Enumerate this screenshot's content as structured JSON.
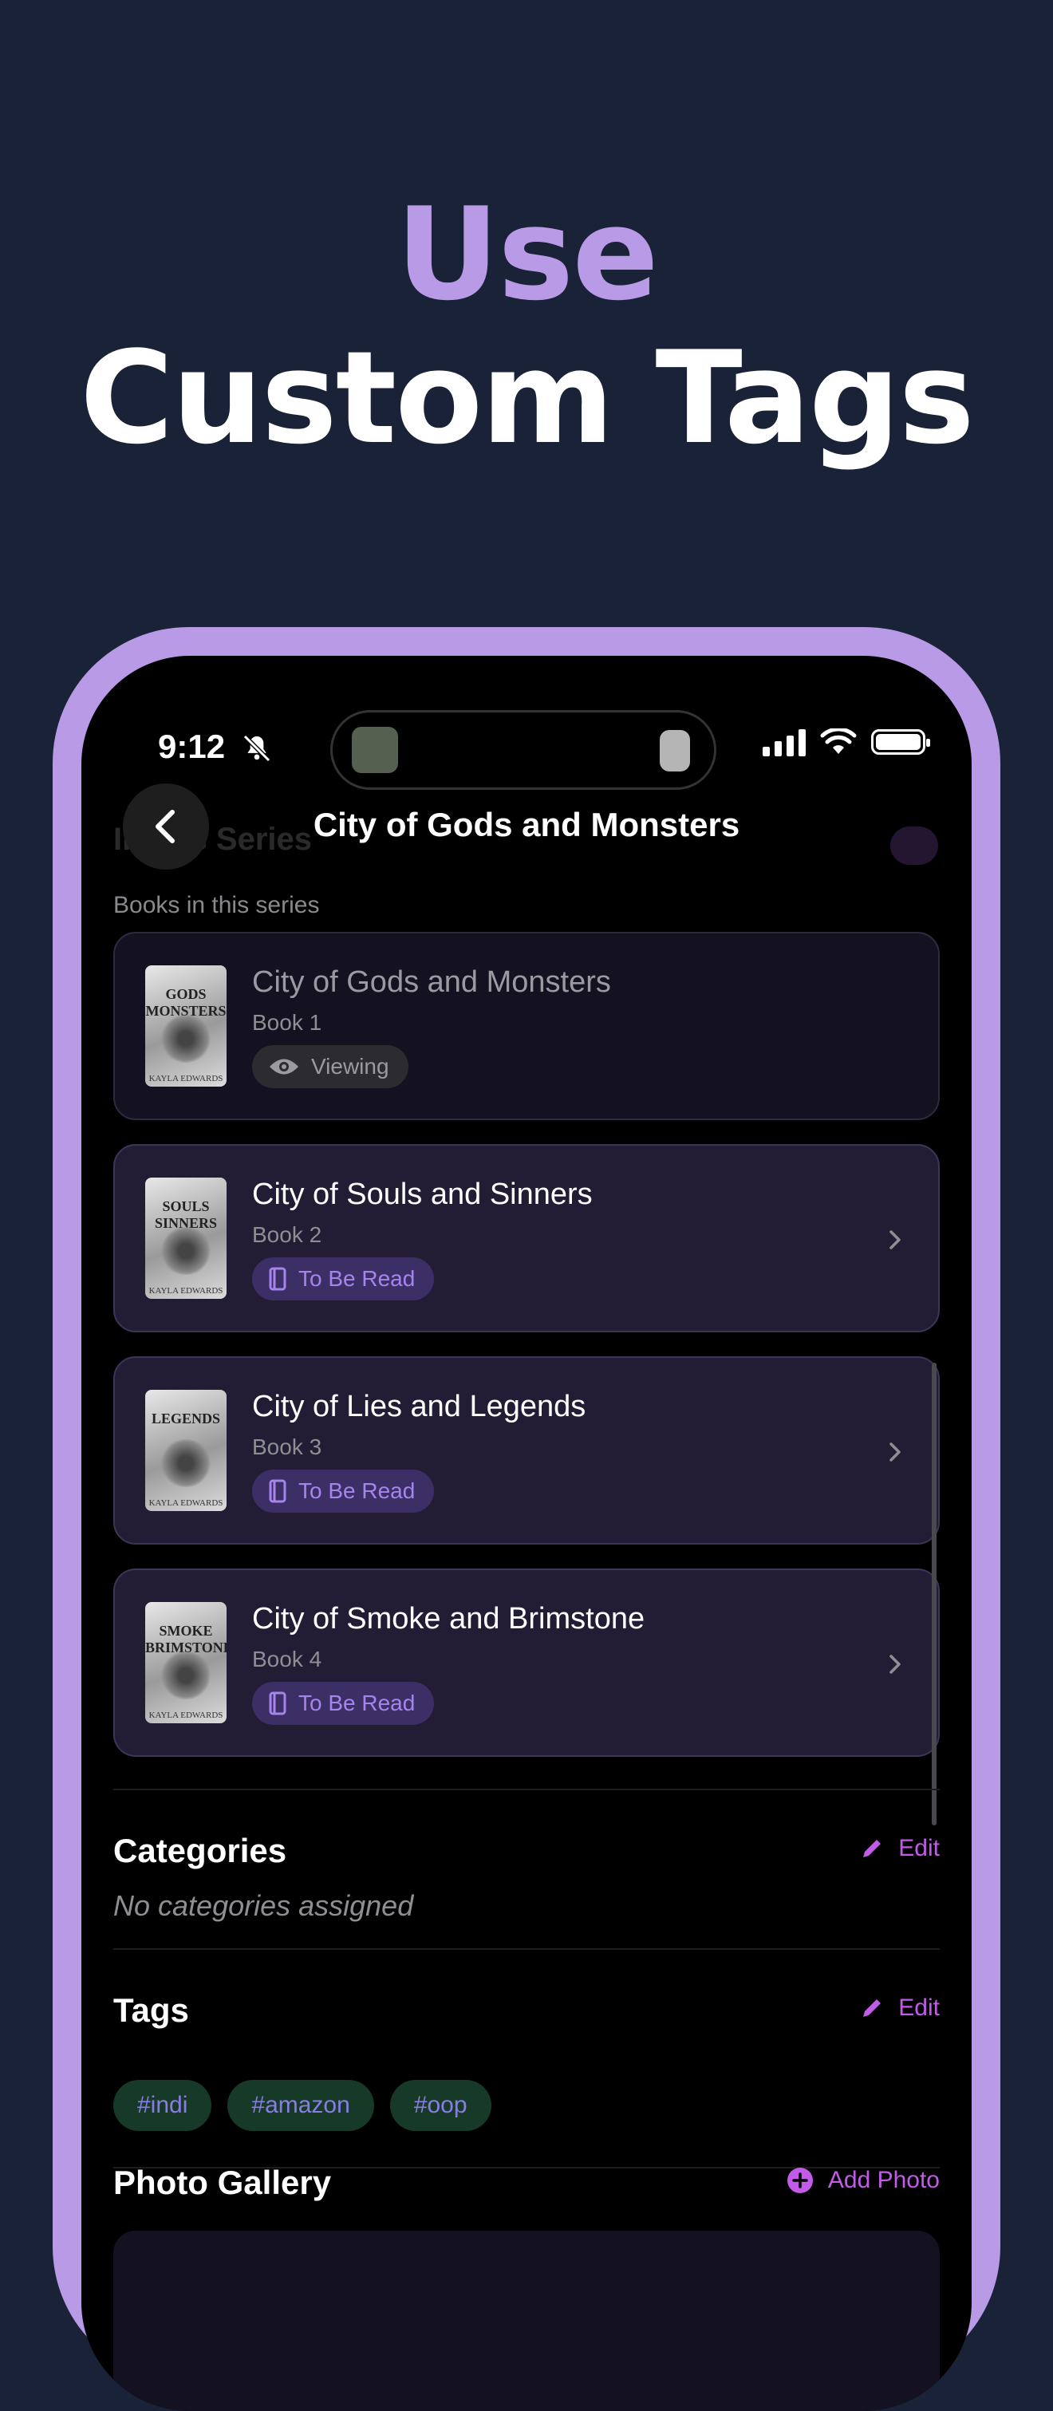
{
  "headline": {
    "line1": "Use",
    "line2": "Custom Tags"
  },
  "status_bar": {
    "time": "9:12"
  },
  "nav": {
    "title": "City of Gods and Monsters",
    "ghost_section": "In this Series"
  },
  "series": {
    "caption": "Books in this series",
    "books": [
      {
        "title": "City of Gods and Monsters",
        "number": "Book 1",
        "status": "Viewing",
        "cover_text": "GODS MONSTERS"
      },
      {
        "title": "City of Souls and Sinners",
        "number": "Book 2",
        "status": "To Be Read",
        "cover_text": "SOULS SINNERS"
      },
      {
        "title": "City of Lies and Legends",
        "number": "Book 3",
        "status": "To Be Read",
        "cover_text": "LEGENDS"
      },
      {
        "title": "City of Smoke and Brimstone",
        "number": "Book 4",
        "status": "To Be Read",
        "cover_text": "SMOKE BRIMSTONE"
      }
    ],
    "cover_author": "KAYLA EDWARDS"
  },
  "categories": {
    "title": "Categories",
    "edit_label": "Edit",
    "empty_text": "No categories assigned"
  },
  "tags": {
    "title": "Tags",
    "edit_label": "Edit",
    "items": [
      "#indi",
      "#amazon",
      "#oop"
    ]
  },
  "gallery": {
    "title": "Photo Gallery",
    "add_label": "Add Photo"
  },
  "colors": {
    "accent": "#b89ae6",
    "link": "#c25be8",
    "background": "#1a2238",
    "tag_bg": "#163a27"
  }
}
